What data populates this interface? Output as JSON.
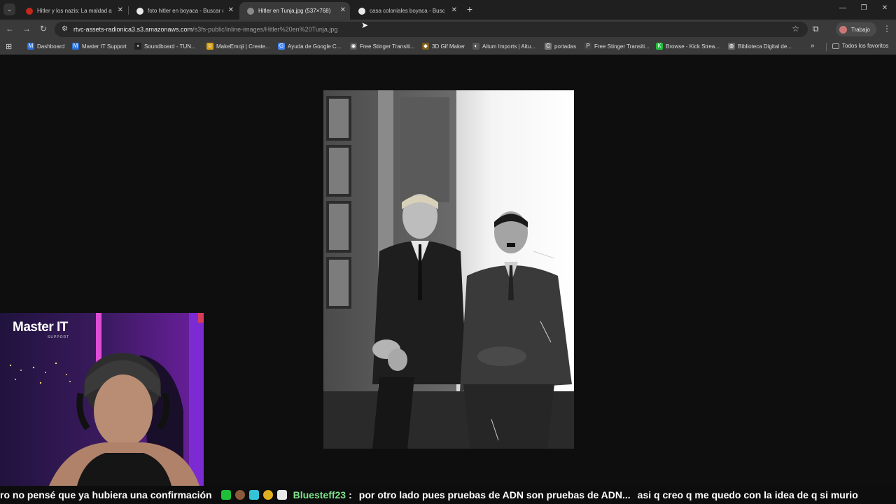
{
  "tabs": [
    {
      "title": "Hitler y los nazis: La maldad a ju",
      "favicon_color": "#c4281c",
      "active": false
    },
    {
      "title": "foto hitler en boyaca - Buscar c",
      "favicon_color": "#e8e8e8",
      "active": false
    },
    {
      "title": "Hitler en Tunja.jpg (537×768)",
      "favicon_color": "#8a8a8a",
      "active": true
    },
    {
      "title": "casa coloniales boyaca - Buscar",
      "favicon_color": "#e8e8e8",
      "active": false
    }
  ],
  "address_bar": {
    "host": "rtvc-assets-radionica3.s3.amazonaws.com",
    "path": "/s3fs-public/inline-images/Hitler%20en%20Tunja.jpg"
  },
  "profile": {
    "label": "Trabajo"
  },
  "bookmarks": [
    {
      "label": "Dashboard",
      "icon_color": "#2b6fd6",
      "glyph": "M"
    },
    {
      "label": "Master IT Support",
      "icon_color": "#2b6fd6",
      "glyph": "M"
    },
    {
      "label": "Soundboard - TUN...",
      "icon_color": "#222222",
      "glyph": "▪"
    },
    {
      "label": "MakeEmoji | Create...",
      "icon_color": "#d4a017",
      "glyph": "☺"
    },
    {
      "label": "Ayuda de Google C...",
      "icon_color": "#4285f4",
      "glyph": "G"
    },
    {
      "label": "Free Stinger Transiti...",
      "icon_color": "#555555",
      "glyph": "◉"
    },
    {
      "label": "3D Gif Maker",
      "icon_color": "#7a5c1e",
      "glyph": "◆"
    },
    {
      "label": "Aitum Imports | Aitu...",
      "icon_color": "#555555",
      "glyph": "◐"
    },
    {
      "label": "portadas",
      "icon_color": "#777777",
      "glyph": "C"
    },
    {
      "label": "Free Stinger Transiti...",
      "icon_color": "#444444",
      "glyph": "P"
    },
    {
      "label": "Browse - Kick Strea...",
      "icon_color": "#1fbf3a",
      "glyph": "K"
    },
    {
      "label": "Biblioteca Digital de...",
      "icon_color": "#666666",
      "glyph": "◍"
    }
  ],
  "bookmarks_all": "Todos los favoritos",
  "webcam": {
    "brand": "Master IT",
    "brand_sub": "SUPPORT"
  },
  "chat_ticker": {
    "prev_message": "ro no pensé que ya hubiera una confirmación",
    "username": "Bluesteff23",
    "separator": ":",
    "message": "por otro lado pues pruebas de ADN son pruebas de ADN...",
    "message_2": "asi q creo q me quedo con la idea de q si murio",
    "username_color": "#7ee38a"
  }
}
